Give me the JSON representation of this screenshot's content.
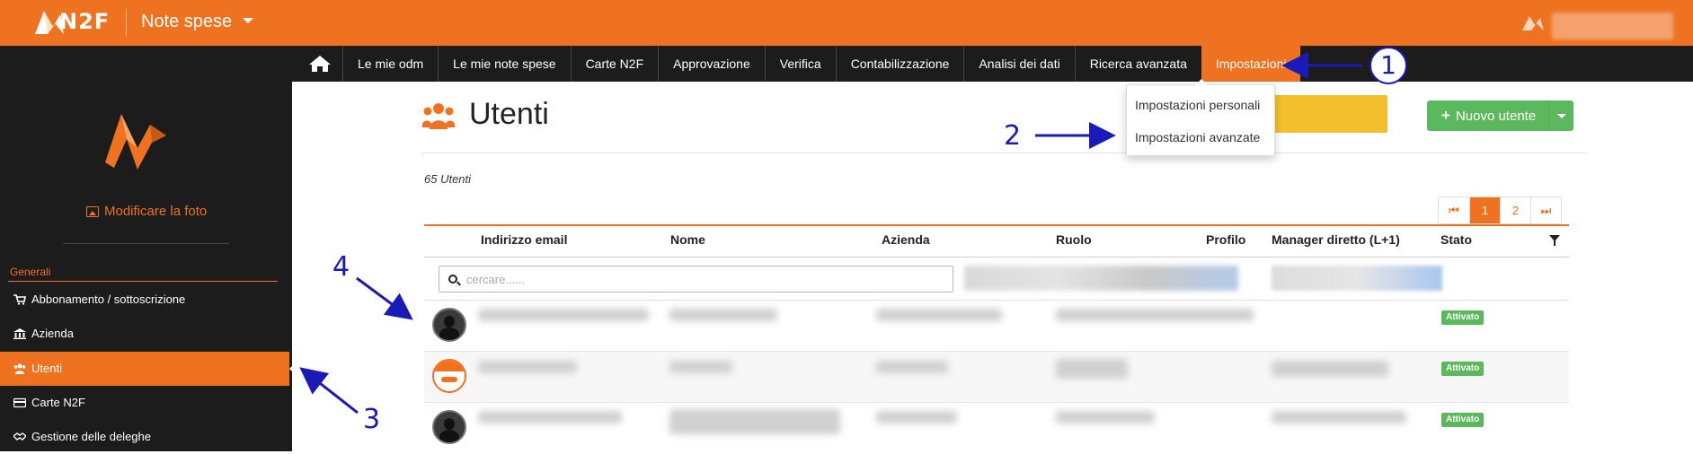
{
  "header": {
    "logo_text": "N2F",
    "app_title": "Note spese"
  },
  "nav": {
    "items": [
      "Le mie odm",
      "Le mie note spese",
      "Carte N2F",
      "Approvazione",
      "Verifica",
      "Contabilizzazione",
      "Analisi dei dati",
      "Ricerca avanzata",
      "Impostazioni"
    ],
    "active": "Impostazioni"
  },
  "dropdown": {
    "items": [
      "Impostazioni personali",
      "Impostazioni avanzate"
    ]
  },
  "sidebar": {
    "photo_link": "Modificare la foto",
    "section": "Generali",
    "items": [
      {
        "label": "Abbonamento / sottoscrizione",
        "icon": "cart-icon"
      },
      {
        "label": "Azienda",
        "icon": "bank-icon"
      },
      {
        "label": "Utenti",
        "icon": "users-icon",
        "active": true
      },
      {
        "label": "Carte N2F",
        "icon": "credit-card-icon"
      },
      {
        "label": "Gestione delle deleghe",
        "icon": "handshake-icon"
      }
    ]
  },
  "main": {
    "title": "Utenti",
    "new_button": "Nuovo utente",
    "user_count": "65 Utenti",
    "pagination": {
      "pages": [
        "1",
        "2"
      ],
      "active": "1"
    },
    "search_placeholder": "cercare......",
    "table": {
      "headers": [
        "Indirizzo email",
        "Nome",
        "Azienda",
        "Ruolo",
        "Profilo",
        "Manager diretto (L+1)",
        "Stato"
      ],
      "rows": [
        {
          "status": "Attivato"
        },
        {
          "status": "Attivato"
        },
        {
          "status": "Attivato"
        }
      ]
    }
  },
  "annotations": [
    "1",
    "2",
    "3",
    "4"
  ],
  "colors": {
    "brand_orange": "#ef7221",
    "dark_nav": "#1c1c1c",
    "success_green": "#5cb85c",
    "annotation_blue": "#1a1ab8",
    "yellow": "#f3c02d"
  }
}
